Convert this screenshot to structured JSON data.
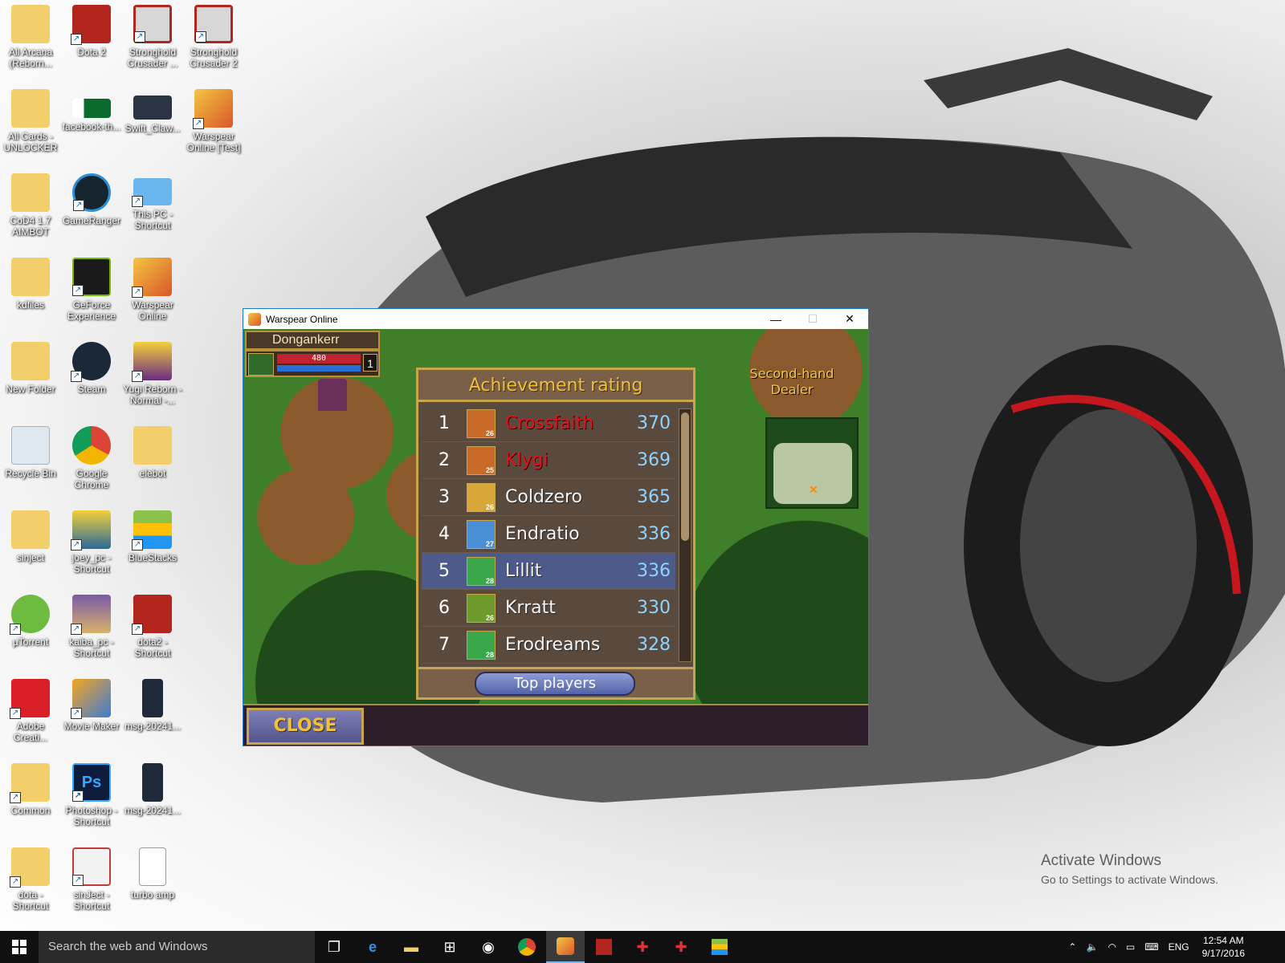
{
  "desktop": {
    "icons": [
      {
        "label": "All Arcana (Reborn...",
        "icon": "folder-icon"
      },
      {
        "label": "Dota 2",
        "icon": "dota-icon"
      },
      {
        "label": "Stronghold Crusader ...",
        "icon": "shield-icon"
      },
      {
        "label": "Stronghold Crusader 2",
        "icon": "shield-icon"
      },
      {
        "label": "All Cards - UNLOCKER",
        "icon": "folder-icon"
      },
      {
        "label": "facebook-th...",
        "icon": "image-icon"
      },
      {
        "label": "Swift_Claw...",
        "icon": "image-icon"
      },
      {
        "label": "Warspear Online [Test]",
        "icon": "warspear-icon"
      },
      {
        "label": "CoD4 1.7 AIMBOT",
        "icon": "folder-icon"
      },
      {
        "label": "GameRanger",
        "icon": "gameranger-icon"
      },
      {
        "label": "This PC - Shortcut",
        "icon": "pc-icon"
      },
      {
        "label": "kdfiles",
        "icon": "folder-icon"
      },
      {
        "label": "GeForce Experience",
        "icon": "nvidia-icon"
      },
      {
        "label": "Warspear Online",
        "icon": "warspear-icon"
      },
      {
        "label": "New Folder",
        "icon": "folder-icon"
      },
      {
        "label": "Steam",
        "icon": "steam-icon"
      },
      {
        "label": "Yugi Reborn - Normal -...",
        "icon": "yugi-icon"
      },
      {
        "label": "Recycle Bin",
        "icon": "recycle-bin-icon"
      },
      {
        "label": "Google Chrome",
        "icon": "chrome-icon"
      },
      {
        "label": "elebot",
        "icon": "folder-icon"
      },
      {
        "label": "sinject",
        "icon": "folder-icon"
      },
      {
        "label": "joey_pc - Shortcut",
        "icon": "yugi-icon"
      },
      {
        "label": "BlueStacks",
        "icon": "bluestacks-icon"
      },
      {
        "label": "µTorrent",
        "icon": "utorrent-icon"
      },
      {
        "label": "kaiba_pc - Shortcut",
        "icon": "yugi-icon"
      },
      {
        "label": "dota2 - Shortcut",
        "icon": "dota-icon"
      },
      {
        "label": "Adobe Creati...",
        "icon": "adobe-cc-icon"
      },
      {
        "label": "Movie Maker",
        "icon": "movie-maker-icon"
      },
      {
        "label": "msg-20241...",
        "icon": "phone-image-icon"
      },
      {
        "label": "Common",
        "icon": "folder-icon"
      },
      {
        "label": "Photoshop - Shortcut",
        "icon": "photoshop-icon"
      },
      {
        "label": "msg-20241...",
        "icon": "phone-image-icon"
      },
      {
        "label": "dota - Shortcut",
        "icon": "folder-icon"
      },
      {
        "label": "sinJect - Shortcut",
        "icon": "sinject-icon"
      },
      {
        "label": "turbo amp",
        "icon": "text-file-icon"
      }
    ]
  },
  "window": {
    "title": "Warspear Online",
    "minimize": "—",
    "maximize": "☐",
    "close": "✕"
  },
  "game": {
    "player_name": "Dongankerr",
    "hp": "480",
    "level": "1",
    "npc_label": "Second-hand Dealer",
    "dialog": {
      "title": "Achievement rating",
      "rows": [
        {
          "rank": "1",
          "name": "Crossfaith",
          "level": "26",
          "score": "370",
          "red": true
        },
        {
          "rank": "2",
          "name": "Klygi",
          "level": "25",
          "score": "369",
          "red": true
        },
        {
          "rank": "3",
          "name": "Coldzero",
          "level": "26",
          "score": "365",
          "red": false
        },
        {
          "rank": "4",
          "name": "Endratio",
          "level": "27",
          "score": "336",
          "red": false
        },
        {
          "rank": "5",
          "name": "Lillit",
          "level": "28",
          "score": "336",
          "red": false
        },
        {
          "rank": "6",
          "name": "Krratt",
          "level": "26",
          "score": "330",
          "red": false
        },
        {
          "rank": "7",
          "name": "Erodreams",
          "level": "28",
          "score": "328",
          "red": false
        }
      ],
      "top_players_label": "Top players"
    },
    "close_label": "CLOSE"
  },
  "activation": {
    "line1": "Activate Windows",
    "line2": "Go to Settings to activate Windows."
  },
  "taskbar": {
    "search_placeholder": "Search the web and Windows",
    "language": "ENG",
    "time": "12:54 AM",
    "date": "9/17/2016"
  }
}
